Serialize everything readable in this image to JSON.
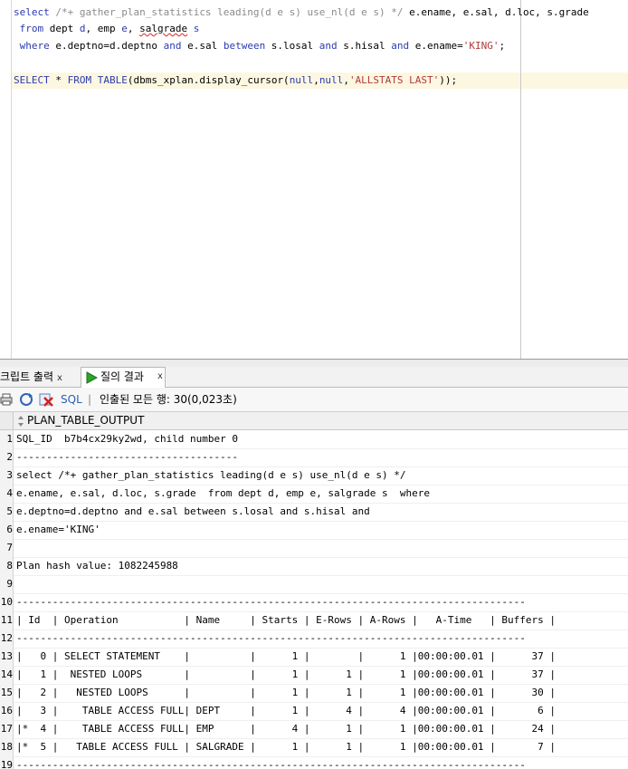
{
  "editor": {
    "lines": [
      [
        {
          "t": "select",
          "c": "kw"
        },
        {
          "t": " /*+ gather_plan_statistics leading(d e s) use_nl(d e s) */ ",
          "c": "cm"
        },
        {
          "t": "e.ename, e.sal, d.loc, s.grade",
          "c": "tx"
        }
      ],
      [
        {
          "t": " from",
          "c": "kw"
        },
        {
          "t": " dept ",
          "c": "tx"
        },
        {
          "t": "d",
          "c": "kw"
        },
        {
          "t": ", emp ",
          "c": "tx"
        },
        {
          "t": "e",
          "c": "kw"
        },
        {
          "t": ", ",
          "c": "tx"
        },
        {
          "t": "salgrade",
          "c": "tx",
          "squig": true
        },
        {
          "t": " ",
          "c": "tx"
        },
        {
          "t": "s",
          "c": "kw"
        }
      ],
      [
        {
          "t": " where",
          "c": "kw"
        },
        {
          "t": " e.deptno=d.deptno ",
          "c": "tx"
        },
        {
          "t": "and",
          "c": "kw"
        },
        {
          "t": " e.sal ",
          "c": "tx"
        },
        {
          "t": "between",
          "c": "kw"
        },
        {
          "t": " s.losal ",
          "c": "tx"
        },
        {
          "t": "and",
          "c": "kw"
        },
        {
          "t": " s.hisal ",
          "c": "tx"
        },
        {
          "t": "and",
          "c": "kw"
        },
        {
          "t": " e.ename=",
          "c": "tx"
        },
        {
          "t": "'KING'",
          "c": "str"
        },
        {
          "t": ";",
          "c": "tx"
        }
      ],
      [],
      [
        {
          "t": "SELECT",
          "c": "kw"
        },
        {
          "t": " * ",
          "c": "tx"
        },
        {
          "t": "FROM",
          "c": "kw"
        },
        {
          "t": " ",
          "c": "tx"
        },
        {
          "t": "TABLE",
          "c": "kw"
        },
        {
          "t": "(dbms_xplan.display_cursor(",
          "c": "tx"
        },
        {
          "t": "null",
          "c": "kw"
        },
        {
          "t": ",",
          "c": "tx"
        },
        {
          "t": "null",
          "c": "kw"
        },
        {
          "t": ",",
          "c": "tx"
        },
        {
          "t": "'ALLSTATS LAST'",
          "c": "str"
        },
        {
          "t": "));",
          "c": "tx"
        }
      ]
    ]
  },
  "tabs": {
    "script_output": "크립트 출력",
    "query_result": "질의 결과",
    "close": "x"
  },
  "toolbar": {
    "sql_label": "SQL",
    "separator": "|",
    "status": "인출된 모든 행: 30(0,023초)"
  },
  "grid": {
    "column_header": "PLAN_TABLE_OUTPUT",
    "rows": [
      {
        "n": "1",
        "v": "SQL_ID  b7b4cx29ky2wd, child number 0"
      },
      {
        "n": "2",
        "v": "-------------------------------------"
      },
      {
        "n": "3",
        "v": "select /*+ gather_plan_statistics leading(d e s) use_nl(d e s) */"
      },
      {
        "n": "4",
        "v": "e.ename, e.sal, d.loc, s.grade  from dept d, emp e, salgrade s  where"
      },
      {
        "n": "5",
        "v": "e.deptno=d.deptno and e.sal between s.losal and s.hisal and"
      },
      {
        "n": "6",
        "v": "e.ename='KING'"
      },
      {
        "n": "7",
        "v": ""
      },
      {
        "n": "8",
        "v": "Plan hash value: 1082245988"
      },
      {
        "n": "9",
        "v": ""
      },
      {
        "n": "10",
        "v": "-------------------------------------------------------------------------------------"
      },
      {
        "n": "11",
        "v": "| Id  | Operation           | Name     | Starts | E-Rows | A-Rows |   A-Time   | Buffers |"
      },
      {
        "n": "12",
        "v": "-------------------------------------------------------------------------------------"
      },
      {
        "n": "13",
        "v": "|   0 | SELECT STATEMENT    |          |      1 |        |      1 |00:00:00.01 |      37 |"
      },
      {
        "n": "14",
        "v": "|   1 |  NESTED LOOPS       |          |      1 |      1 |      1 |00:00:00.01 |      37 |"
      },
      {
        "n": "15",
        "v": "|   2 |   NESTED LOOPS      |          |      1 |      1 |      1 |00:00:00.01 |      30 |"
      },
      {
        "n": "16",
        "v": "|   3 |    TABLE ACCESS FULL| DEPT     |      1 |      4 |      4 |00:00:00.01 |       6 |"
      },
      {
        "n": "17",
        "v": "|*  4 |    TABLE ACCESS FULL| EMP      |      4 |      1 |      1 |00:00:00.01 |      24 |"
      },
      {
        "n": "18",
        "v": "|*  5 |   TABLE ACCESS FULL | SALGRADE |      1 |      1 |      1 |00:00:00.01 |       7 |"
      },
      {
        "n": "19",
        "v": "-------------------------------------------------------------------------------------"
      }
    ]
  }
}
